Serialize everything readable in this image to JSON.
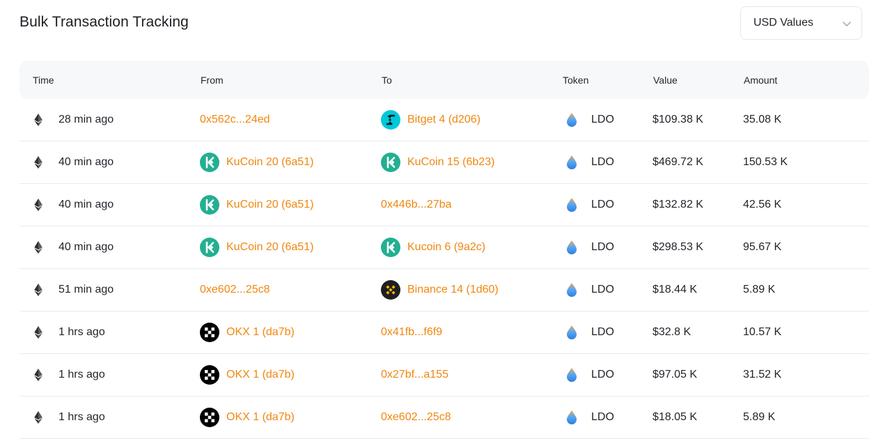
{
  "header": {
    "title": "Bulk Transaction Tracking",
    "currency_select": "USD Values"
  },
  "table": {
    "columns": [
      "Time",
      "From",
      "To",
      "Token",
      "Value",
      "Amount"
    ],
    "rows": [
      {
        "time": "28 min ago",
        "from": {
          "label": "0x562c...24ed",
          "icon": ""
        },
        "to": {
          "label": "Bitget 4 (d206)",
          "icon": "bitget-icon"
        },
        "token": "LDO",
        "value": "$109.38 K",
        "amount": "35.08 K"
      },
      {
        "time": "40 min ago",
        "from": {
          "label": "KuCoin 20 (6a51)",
          "icon": "kucoin-icon"
        },
        "to": {
          "label": "KuCoin 15 (6b23)",
          "icon": "kucoin-icon"
        },
        "token": "LDO",
        "value": "$469.72 K",
        "amount": "150.53 K"
      },
      {
        "time": "40 min ago",
        "from": {
          "label": "KuCoin 20 (6a51)",
          "icon": "kucoin-icon"
        },
        "to": {
          "label": "0x446b...27ba",
          "icon": ""
        },
        "token": "LDO",
        "value": "$132.82 K",
        "amount": "42.56 K"
      },
      {
        "time": "40 min ago",
        "from": {
          "label": "KuCoin 20 (6a51)",
          "icon": "kucoin-icon"
        },
        "to": {
          "label": "Kucoin 6 (9a2c)",
          "icon": "kucoin-icon"
        },
        "token": "LDO",
        "value": "$298.53 K",
        "amount": "95.67 K"
      },
      {
        "time": "51 min ago",
        "from": {
          "label": "0xe602...25c8",
          "icon": ""
        },
        "to": {
          "label": "Binance 14 (1d60)",
          "icon": "binance-icon"
        },
        "token": "LDO",
        "value": "$18.44 K",
        "amount": "5.89 K"
      },
      {
        "time": "1 hrs ago",
        "from": {
          "label": "OKX 1 (da7b)",
          "icon": "okx-icon"
        },
        "to": {
          "label": "0x41fb...f6f9",
          "icon": ""
        },
        "token": "LDO",
        "value": "$32.8 K",
        "amount": "10.57 K"
      },
      {
        "time": "1 hrs ago",
        "from": {
          "label": "OKX 1 (da7b)",
          "icon": "okx-icon"
        },
        "to": {
          "label": "0x27bf...a155",
          "icon": ""
        },
        "token": "LDO",
        "value": "$97.05 K",
        "amount": "31.52 K"
      },
      {
        "time": "1 hrs ago",
        "from": {
          "label": "OKX 1 (da7b)",
          "icon": "okx-icon"
        },
        "to": {
          "label": "0xe602...25c8",
          "icon": ""
        },
        "token": "LDO",
        "value": "$18.05 K",
        "amount": "5.89 K"
      }
    ]
  },
  "colors": {
    "link": "#f0870f",
    "kucoin": "#23af91",
    "bitget": "#00c8d8",
    "binance": "#f0b90b",
    "okx": "#000000"
  }
}
